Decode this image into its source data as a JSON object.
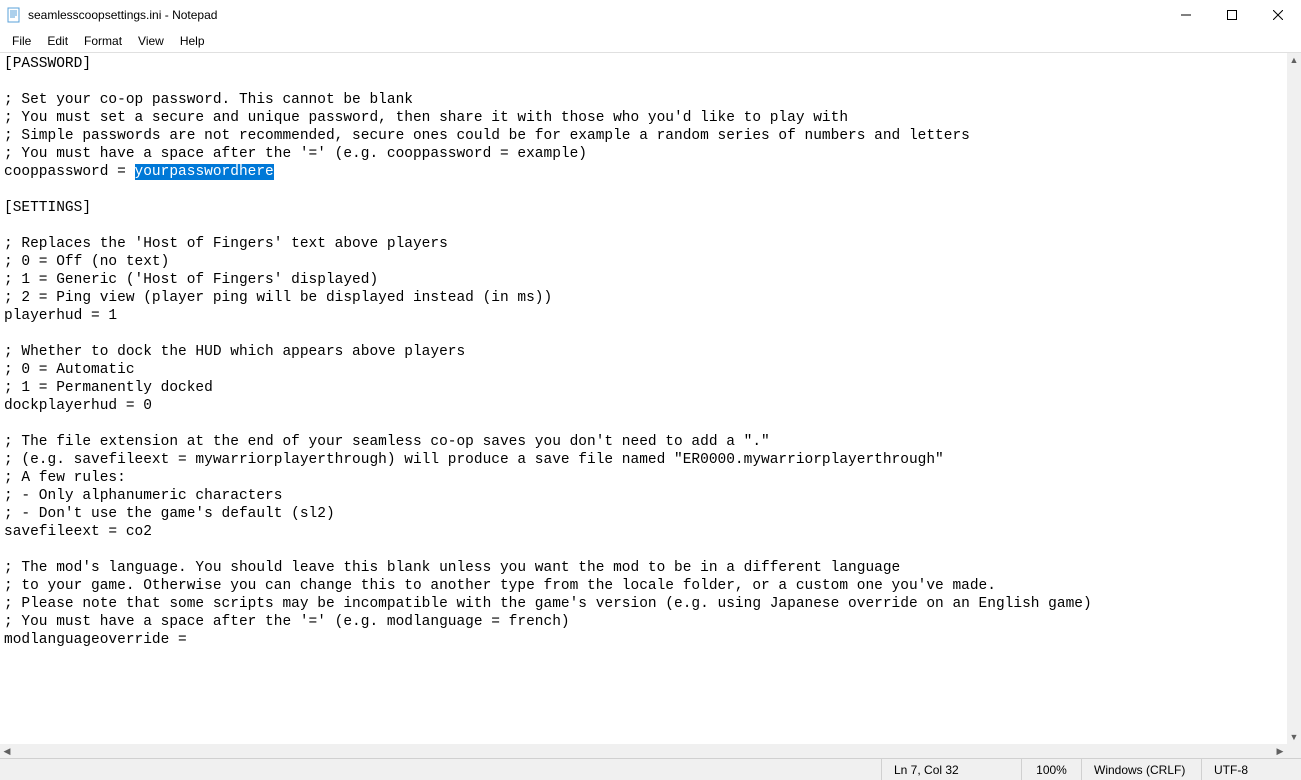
{
  "window": {
    "title": "seamlesscoopsettings.ini - Notepad"
  },
  "menu": {
    "file": "File",
    "edit": "Edit",
    "format": "Format",
    "view": "View",
    "help": "Help"
  },
  "editor": {
    "lines": [
      "[PASSWORD]",
      "",
      "; Set your co-op password. This cannot be blank",
      "; You must set a secure and unique password, then share it with those who you'd like to play with",
      "; Simple passwords are not recommended, secure ones could be for example a random series of numbers and letters",
      "; You must have a space after the '=' (e.g. cooppassword = example)",
      "cooppassword = ",
      "",
      "[SETTINGS]",
      "",
      "; Replaces the 'Host of Fingers' text above players",
      "; 0 = Off (no text)",
      "; 1 = Generic ('Host of Fingers' displayed)",
      "; 2 = Ping view (player ping will be displayed instead (in ms))",
      "playerhud = 1",
      "",
      "; Whether to dock the HUD which appears above players",
      "; 0 = Automatic",
      "; 1 = Permanently docked",
      "dockplayerhud = 0",
      "",
      "; The file extension at the end of your seamless co-op saves you don't need to add a \".\"",
      "; (e.g. savefileext = mywarriorplayerthrough) will produce a save file named \"ER0000.mywarriorplayerthrough\"",
      "; A few rules:",
      "; - Only alphanumeric characters",
      "; - Don't use the game's default (sl2)",
      "savefileext = co2",
      "",
      "; The mod's language. You should leave this blank unless you want the mod to be in a different language",
      "; to your game. Otherwise you can change this to another type from the locale folder, or a custom one you've made.",
      "; Please note that some scripts may be incompatible with the game's version (e.g. using Japanese override on an English game)",
      "; You must have a space after the '=' (e.g. modlanguage = french)",
      "modlanguageoverride = "
    ],
    "selection": {
      "line_index": 6,
      "text": "yourpasswordhere"
    }
  },
  "status": {
    "position": "Ln 7, Col 32",
    "zoom": "100%",
    "eol": "Windows (CRLF)",
    "encoding": "UTF-8"
  }
}
